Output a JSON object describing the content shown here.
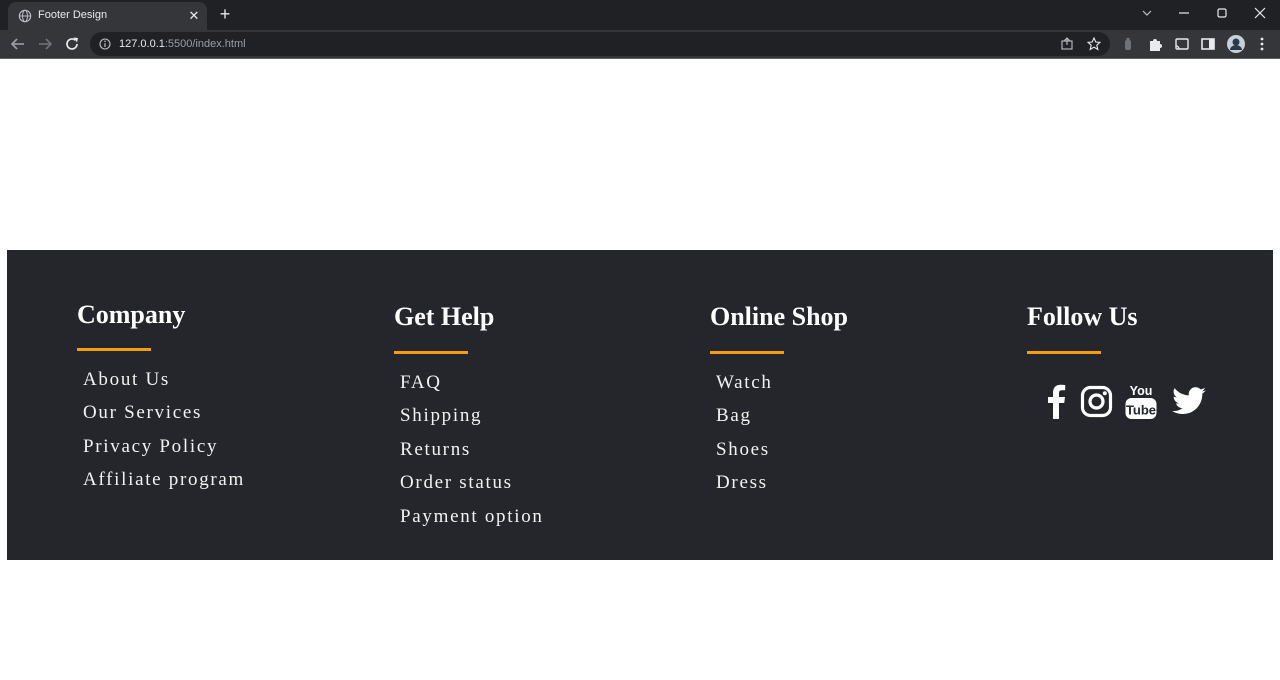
{
  "browser": {
    "tab_title": "Footer Design",
    "url_host": "127.0.0.1",
    "url_rest": ":5500/index.html"
  },
  "footer": {
    "columns": [
      {
        "heading": "Company",
        "links": [
          "About Us",
          "Our Services",
          "Privacy Policy",
          "Affiliate program"
        ]
      },
      {
        "heading": "Get Help",
        "links": [
          "FAQ",
          "Shipping",
          "Returns",
          "Order status",
          "Payment option"
        ]
      },
      {
        "heading": "Online Shop",
        "links": [
          "Watch",
          "Bag",
          "Shoes",
          "Dress"
        ]
      },
      {
        "heading": "Follow Us",
        "links": []
      }
    ],
    "social": [
      "facebook-icon",
      "instagram-icon",
      "youtube-icon",
      "twitter-icon"
    ],
    "accent_color": "#f59c10",
    "background_color": "#24262b"
  }
}
